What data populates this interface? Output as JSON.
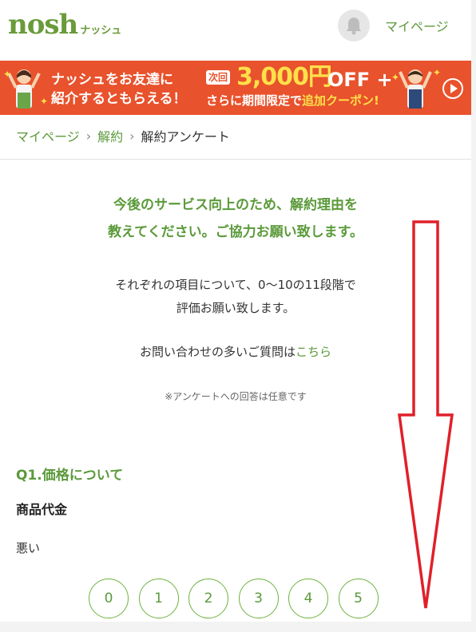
{
  "header": {
    "logo_main": "nosh",
    "logo_sub": "ナッシュ",
    "mypage_label": "マイページ"
  },
  "banner": {
    "left_line1": "ナッシュをお友達に",
    "left_line2": "紹介するともらえる！",
    "next_badge": "次回",
    "amount": "3,000円",
    "off": "OFF +",
    "line2_a": "さらに期間限定で",
    "line2_b": "追加クーポン!"
  },
  "breadcrumb": {
    "items": [
      "マイページ",
      "解約"
    ],
    "current": "解約アンケート"
  },
  "intro": {
    "lead_line1": "今後のサービス向上のため、解約理由を",
    "lead_line2": "教えてください。ご協力お願い致します。",
    "desc_line1": "それぞれの項目について、0〜10の11段階で",
    "desc_line2": "評価お願い致します。",
    "faq_text": "お問い合わせの多いご質問は",
    "faq_link": "こちら",
    "note": "※アンケートへの回答は任意です"
  },
  "question": {
    "title": "Q1.価格について",
    "item": "商品代金",
    "low_label": "悪い",
    "scale": [
      "0",
      "1",
      "2",
      "3",
      "4",
      "5"
    ]
  },
  "colors": {
    "brand_green": "#5b9a3a",
    "banner_orange": "#e8522c",
    "annotation_red": "#e0202a"
  },
  "icons": [
    "bell-icon",
    "chevron-right-icon",
    "play-icon",
    "down-arrow-annotation"
  ]
}
